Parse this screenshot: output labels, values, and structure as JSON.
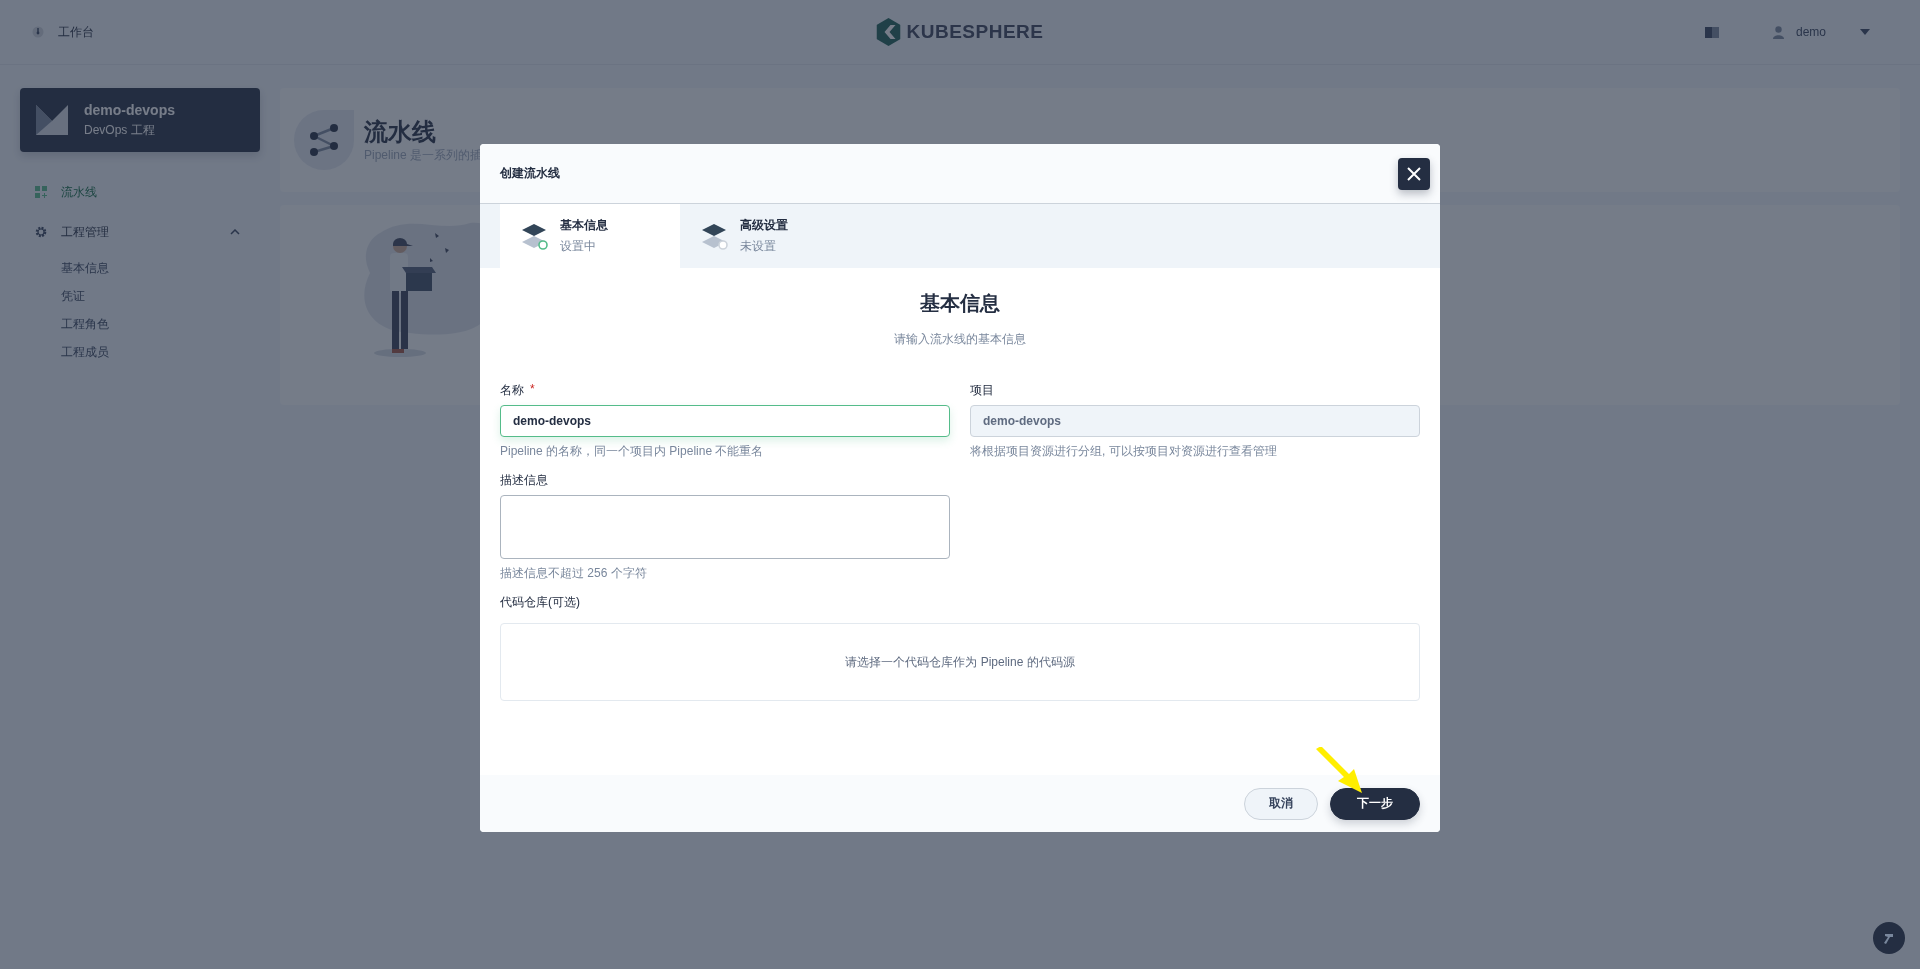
{
  "topbar": {
    "workbench": "工作台",
    "logo": "KUBESPHERE",
    "user": "demo"
  },
  "sidebar": {
    "project": {
      "name": "demo-devops",
      "type": "DevOps 工程"
    },
    "items": [
      {
        "kind": "link",
        "label": "流水线",
        "selected": true
      },
      {
        "kind": "group",
        "label": "工程管理",
        "selected": false,
        "expanded": true,
        "children": [
          {
            "label": "基本信息",
            "selected": false
          },
          {
            "label": "凭证",
            "selected": false
          },
          {
            "label": "工程角色",
            "selected": false
          },
          {
            "label": "工程成员",
            "selected": false
          }
        ]
      }
    ]
  },
  "page": {
    "title": "流水线",
    "description": "Pipeline 是一系列的插"
  },
  "modal": {
    "title": "创建流水线",
    "steps": [
      {
        "title": "基本信息",
        "status": "设置中",
        "selected": true
      },
      {
        "title": "高级设置",
        "status": "未设置",
        "selected": false
      }
    ],
    "heading": "基本信息",
    "subheading": "请输入流水线的基本信息",
    "fields": [
      {
        "kind": "input",
        "label": "名称",
        "required_mark": "*",
        "value": "demo-devops",
        "focused": true,
        "disabled": false,
        "hint": "Pipeline 的名称，同一个项目内 Pipeline 不能重名"
      },
      {
        "kind": "input",
        "label": "项目",
        "value": "demo-devops",
        "focused": false,
        "disabled": true,
        "hint": "将根据项目资源进行分组, 可以按项目对资源进行查看管理"
      },
      {
        "kind": "textarea",
        "label": "描述信息",
        "focused": false,
        "hint": "描述信息不超过 256 个字符"
      },
      {
        "kind": "repo",
        "label": "代码仓库(可选)",
        "prompt": "请选择一个代码仓库作为 Pipeline 的代码源"
      }
    ],
    "buttons": [
      {
        "kind": "secondary",
        "label": "取消"
      },
      {
        "kind": "primary",
        "label": "下一步"
      }
    ]
  }
}
